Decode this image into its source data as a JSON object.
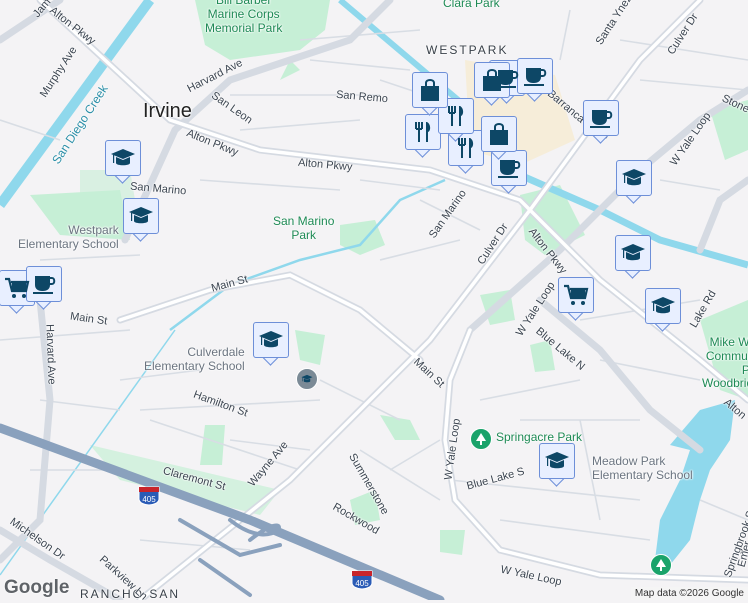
{
  "map": {
    "city_label": "Irvine",
    "area_labels": [
      "WESTPARK",
      "RANCHO SAN"
    ],
    "parks": [
      "Bill Barber\nMarine Corps\nMemorial Park",
      "Clara Park",
      "San Marino\nPark",
      "Springacre Park",
      "Mike Ward\nCommunity\nPark\nWoodbridge"
    ],
    "schools": [
      "Westpark\nElementary School",
      "Culverdale\nElementary School",
      "Meadow Park\nElementary School"
    ],
    "water": [
      "San Diego Creek"
    ],
    "streets": {
      "alton1": "Alton Pkwy",
      "alton2": "Alton Pkwy",
      "alton3": "Alton Pkwy",
      "alton4": "Alton Pkwy",
      "alton5": "Alton",
      "harvard1": "Harvard Ave",
      "harvard2": "Harvard Ave",
      "murphy": "Murphy Ave",
      "jam": "Jam",
      "san_leon": "San Leon",
      "san_remo": "San Remo",
      "san_marino1": "San Marino",
      "san_marino2": "San Marino",
      "main1": "Main St",
      "main2": "Main St",
      "main3": "Main St",
      "hamilton": "Hamilton St",
      "claremont": "Claremont St",
      "wayne": "Wayne Ave",
      "michelson": "Michelson Dr",
      "parkview": "Parkview Ln",
      "summerstone": "Summerstone",
      "rockwood": "Rockwood",
      "culver1": "Culver Dr",
      "culver2": "Culver Dr",
      "yale1": "W Yale Loop",
      "yale2": "W Yale Loop",
      "yale3": "W Yale Loop",
      "yale4": "W Yale Loop",
      "blue_n": "Blue Lake N",
      "blue_s": "Blue Lake S",
      "lake_rd": "Lake Rd",
      "santa_ynez": "Santa Ynez",
      "stone": "Stone",
      "barranca": "Barranca Pkwy",
      "springbrook": "Springbrook S",
      "emerald": "Emer"
    },
    "highway_shield": "405",
    "logo": "Google",
    "attribution": "Map data ©2026 Google"
  },
  "colors": {
    "background": "#f4f3f5",
    "park": "#c6efd6",
    "water": "#8fd8ec",
    "freeway": "#8aa1bd",
    "marker_fill": "#e8efff",
    "marker_border": "#6d8fd8",
    "icon": "#0d4766"
  },
  "markers": [
    {
      "type": "school-icon"
    },
    {
      "type": "school-icon"
    },
    {
      "type": "school-icon"
    },
    {
      "type": "school-icon"
    },
    {
      "type": "school-icon"
    },
    {
      "type": "school-icon"
    },
    {
      "type": "school-icon"
    },
    {
      "type": "cart-icon"
    },
    {
      "type": "cart-icon"
    },
    {
      "type": "coffee-icon"
    },
    {
      "type": "coffee-icon"
    },
    {
      "type": "coffee-icon"
    },
    {
      "type": "coffee-icon"
    },
    {
      "type": "coffee-icon"
    },
    {
      "type": "restaurant-icon"
    },
    {
      "type": "restaurant-icon"
    },
    {
      "type": "restaurant-icon"
    },
    {
      "type": "shopping-bag-icon"
    },
    {
      "type": "shopping-bag-icon"
    },
    {
      "type": "shopping-bag-icon"
    }
  ]
}
